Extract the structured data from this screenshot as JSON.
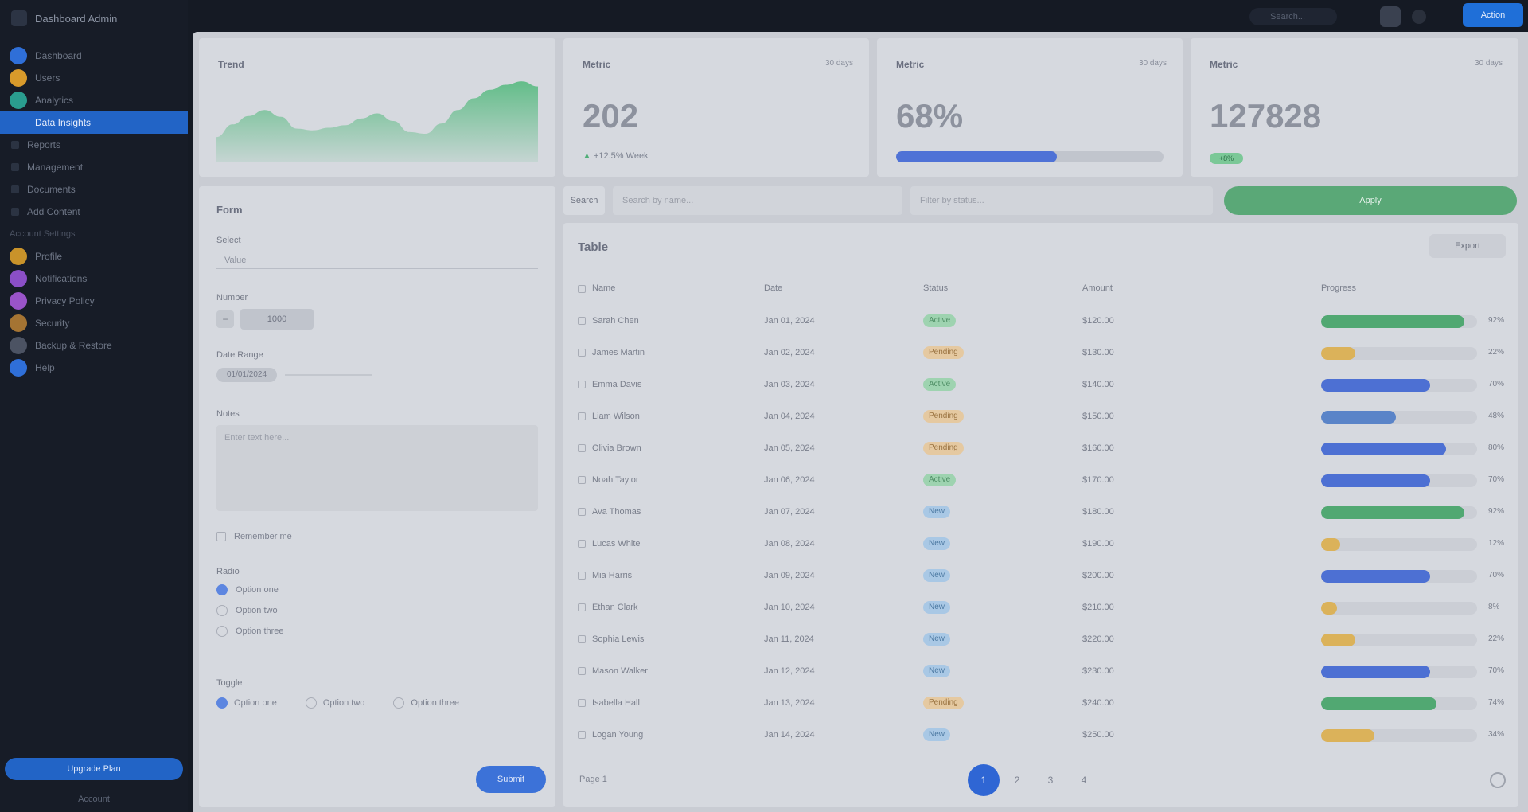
{
  "app": {
    "name": "Dashboard Admin"
  },
  "sidebar": {
    "items": [
      {
        "label": "Dashboard",
        "color": "#2f6fd8",
        "kind": "main"
      },
      {
        "label": "Users",
        "color": "#d89a2b",
        "kind": "main"
      },
      {
        "label": "Analytics",
        "color": "#2a9d8f",
        "kind": "main"
      },
      {
        "label": "Data Insights",
        "color": "#2264c6",
        "kind": "active"
      },
      {
        "label": "Reports",
        "kind": "sub"
      },
      {
        "label": "Management",
        "kind": "sub"
      },
      {
        "label": "Documents",
        "kind": "sub"
      },
      {
        "label": "Add Content",
        "kind": "sub"
      },
      {
        "label": "Account Settings",
        "kind": "group"
      },
      {
        "label": "Profile",
        "color": "#c9932a",
        "kind": "main"
      },
      {
        "label": "Notifications",
        "color": "#8b4fc7",
        "kind": "main"
      },
      {
        "label": "Privacy Policy",
        "color": "#9a54c9",
        "kind": "main"
      },
      {
        "label": "Security",
        "color": "#a57433",
        "kind": "main"
      },
      {
        "label": "Backup & Restore",
        "color": "#4c5363",
        "kind": "main"
      },
      {
        "label": "Help",
        "color": "#2f6fd8",
        "kind": "main"
      }
    ],
    "upgrade_label": "Upgrade Plan",
    "account_label": "Account"
  },
  "topbar": {
    "search_placeholder": "Search...",
    "primary_button": "Action"
  },
  "cards": {
    "chart_title": "Trend",
    "metric1": {
      "title": "Metric",
      "range": "30 days",
      "value": "202",
      "delta": "+12.5%",
      "delta_suffix": "Week"
    },
    "metric2": {
      "title": "Metric",
      "range": "30 days",
      "value": "68%",
      "progress": 0.6
    },
    "metric3": {
      "title": "Metric",
      "range": "30 days",
      "value": "127828",
      "chip": "+8%"
    }
  },
  "form": {
    "title": "Form",
    "fields": {
      "select_label": "Select",
      "select_value": "Value",
      "stepper_label": "Number",
      "stepper_minus": "−",
      "stepper_value": "1000",
      "date_label": "Date Range",
      "date_value": "01/01/2024",
      "textarea_label": "Notes",
      "textarea_placeholder": "Enter text here...",
      "checkbox_label": "Remember me",
      "radio_label": "Radio",
      "radio_options": [
        "Option one",
        "Option two",
        "Option three"
      ],
      "toggle_label": "Toggle",
      "toggle_options": [
        "Option one",
        "Option two",
        "Option three"
      ]
    },
    "submit_label": "Submit"
  },
  "filter": {
    "label": "Search",
    "input1_placeholder": "Search by name...",
    "input2_placeholder": "Filter by status...",
    "button_label": "Apply"
  },
  "table": {
    "title": "Table",
    "export_label": "Export",
    "columns": [
      "Name",
      "Date",
      "Status",
      "Amount",
      "Progress"
    ],
    "rows": [
      {
        "name": "Sarah Chen",
        "date": "Jan 01, 2024",
        "status": "Active",
        "status_kind": "active",
        "amount": "$120.00",
        "progress": 0.92,
        "color": "green",
        "pct": "92%"
      },
      {
        "name": "James Martin",
        "date": "Jan 02, 2024",
        "status": "Pending",
        "status_kind": "pending",
        "amount": "$130.00",
        "progress": 0.22,
        "color": "orange",
        "pct": "22%"
      },
      {
        "name": "Emma Davis",
        "date": "Jan 03, 2024",
        "status": "Active",
        "status_kind": "active",
        "amount": "$140.00",
        "progress": 0.7,
        "color": "blue",
        "pct": "70%"
      },
      {
        "name": "Liam Wilson",
        "date": "Jan 04, 2024",
        "status": "Pending",
        "status_kind": "pending",
        "amount": "$150.00",
        "progress": 0.48,
        "color": "lblue",
        "pct": "48%"
      },
      {
        "name": "Olivia Brown",
        "date": "Jan 05, 2024",
        "status": "Pending",
        "status_kind": "pending",
        "amount": "$160.00",
        "progress": 0.8,
        "color": "blue",
        "pct": "80%"
      },
      {
        "name": "Noah Taylor",
        "date": "Jan 06, 2024",
        "status": "Active",
        "status_kind": "active",
        "amount": "$170.00",
        "progress": 0.7,
        "color": "blue",
        "pct": "70%"
      },
      {
        "name": "Ava Thomas",
        "date": "Jan 07, 2024",
        "status": "New",
        "status_kind": "new",
        "amount": "$180.00",
        "progress": 0.92,
        "color": "green",
        "pct": "92%"
      },
      {
        "name": "Lucas White",
        "date": "Jan 08, 2024",
        "status": "New",
        "status_kind": "new",
        "amount": "$190.00",
        "progress": 0.12,
        "color": "orange",
        "pct": "12%"
      },
      {
        "name": "Mia Harris",
        "date": "Jan 09, 2024",
        "status": "New",
        "status_kind": "new",
        "amount": "$200.00",
        "progress": 0.7,
        "color": "blue",
        "pct": "70%"
      },
      {
        "name": "Ethan Clark",
        "date": "Jan 10, 2024",
        "status": "New",
        "status_kind": "new",
        "amount": "$210.00",
        "progress": 0.08,
        "color": "orange",
        "pct": "8%"
      },
      {
        "name": "Sophia Lewis",
        "date": "Jan 11, 2024",
        "status": "New",
        "status_kind": "new",
        "amount": "$220.00",
        "progress": 0.22,
        "color": "orange",
        "pct": "22%"
      },
      {
        "name": "Mason Walker",
        "date": "Jan 12, 2024",
        "status": "New",
        "status_kind": "new",
        "amount": "$230.00",
        "progress": 0.7,
        "color": "blue",
        "pct": "70%"
      },
      {
        "name": "Isabella Hall",
        "date": "Jan 13, 2024",
        "status": "Pending",
        "status_kind": "pending",
        "amount": "$240.00",
        "progress": 0.74,
        "color": "green",
        "pct": "74%"
      },
      {
        "name": "Logan Young",
        "date": "Jan 14, 2024",
        "status": "New",
        "status_kind": "new",
        "amount": "$250.00",
        "progress": 0.34,
        "color": "orange",
        "pct": "34%"
      }
    ],
    "pager": {
      "info": "Page 1",
      "pages": [
        "1",
        "2",
        "3",
        "4"
      ]
    }
  },
  "chart_data": {
    "type": "area",
    "x": [
      0,
      1,
      2,
      3,
      4,
      5,
      6,
      7,
      8,
      9,
      10,
      11,
      12,
      13,
      14,
      15,
      16,
      17,
      18,
      19,
      20
    ],
    "values": [
      30,
      45,
      55,
      62,
      54,
      40,
      38,
      41,
      44,
      52,
      58,
      49,
      36,
      34,
      46,
      62,
      76,
      86,
      92,
      96,
      90
    ],
    "ylim": [
      0,
      100
    ],
    "color": "#4fb87a"
  }
}
